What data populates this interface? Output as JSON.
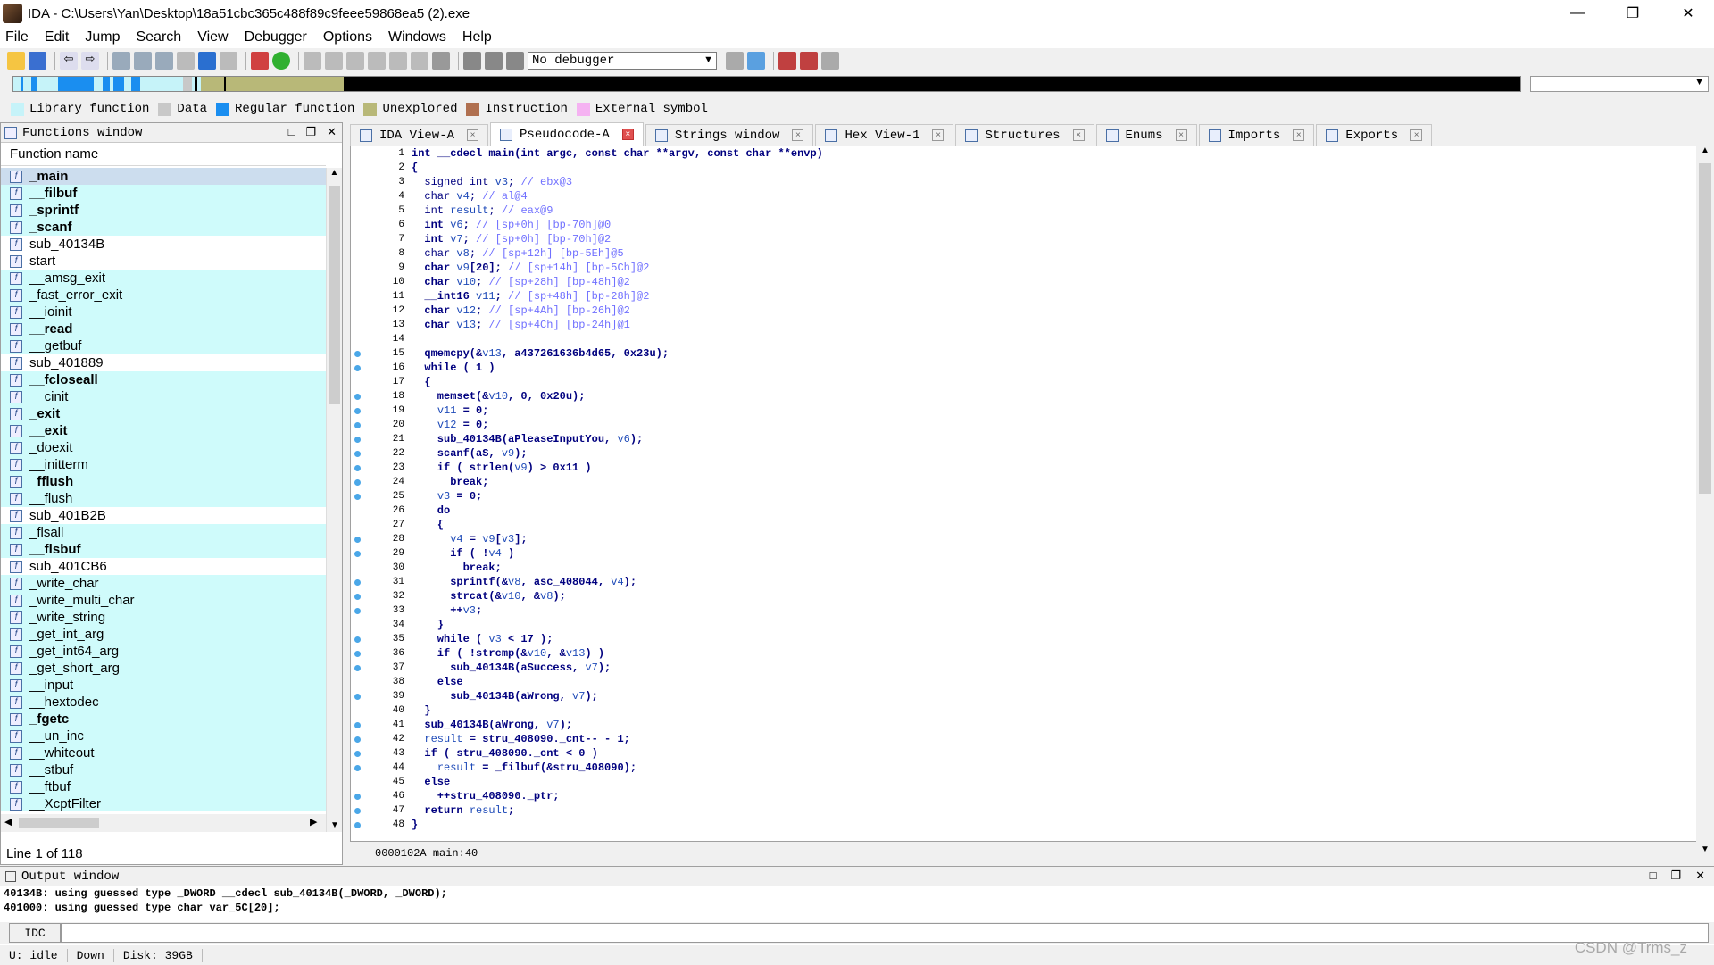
{
  "window": {
    "title": "IDA - C:\\Users\\Yan\\Desktop\\18a51cbc365c488f89c9feee59868ea5 (2).exe"
  },
  "menu": [
    "File",
    "Edit",
    "Jump",
    "Search",
    "View",
    "Debugger",
    "Options",
    "Windows",
    "Help"
  ],
  "toolbar": {
    "debugger_select": "No debugger"
  },
  "legend": [
    {
      "label": "Library function",
      "color": "#c6f3f9"
    },
    {
      "label": "Data",
      "color": "#c8c8c8"
    },
    {
      "label": "Regular function",
      "color": "#1a8ef0"
    },
    {
      "label": "Unexplored",
      "color": "#b8b878"
    },
    {
      "label": "Instruction",
      "color": "#b07050"
    },
    {
      "label": "External symbol",
      "color": "#f5b2f2"
    }
  ],
  "functions_window": {
    "title": "Functions window",
    "column": "Function name",
    "status": "Line 1 of 118",
    "items": [
      {
        "name": "_main",
        "bold": true,
        "lib": true
      },
      {
        "name": "__filbuf",
        "bold": true,
        "lib": true
      },
      {
        "name": "_sprintf",
        "bold": true,
        "lib": true
      },
      {
        "name": "_scanf",
        "bold": true,
        "lib": true
      },
      {
        "name": "sub_40134B",
        "bold": false,
        "lib": false
      },
      {
        "name": "start",
        "bold": false,
        "lib": false
      },
      {
        "name": "__amsg_exit",
        "bold": false,
        "lib": true
      },
      {
        "name": "_fast_error_exit",
        "bold": false,
        "lib": true
      },
      {
        "name": "__ioinit",
        "bold": false,
        "lib": true
      },
      {
        "name": "__read",
        "bold": true,
        "lib": true
      },
      {
        "name": "__getbuf",
        "bold": false,
        "lib": true
      },
      {
        "name": "sub_401889",
        "bold": false,
        "lib": false
      },
      {
        "name": "__fcloseall",
        "bold": true,
        "lib": true
      },
      {
        "name": "__cinit",
        "bold": false,
        "lib": true
      },
      {
        "name": "_exit",
        "bold": true,
        "lib": true
      },
      {
        "name": "__exit",
        "bold": true,
        "lib": true
      },
      {
        "name": "_doexit",
        "bold": false,
        "lib": true
      },
      {
        "name": "__initterm",
        "bold": false,
        "lib": true
      },
      {
        "name": "_fflush",
        "bold": true,
        "lib": true
      },
      {
        "name": "__flush",
        "bold": false,
        "lib": true
      },
      {
        "name": "sub_401B2B",
        "bold": false,
        "lib": false
      },
      {
        "name": "_flsall",
        "bold": false,
        "lib": true
      },
      {
        "name": "__flsbuf",
        "bold": true,
        "lib": true
      },
      {
        "name": "sub_401CB6",
        "bold": false,
        "lib": false
      },
      {
        "name": "_write_char",
        "bold": false,
        "lib": true
      },
      {
        "name": "_write_multi_char",
        "bold": false,
        "lib": true
      },
      {
        "name": "_write_string",
        "bold": false,
        "lib": true
      },
      {
        "name": "_get_int_arg",
        "bold": false,
        "lib": true
      },
      {
        "name": "_get_int64_arg",
        "bold": false,
        "lib": true
      },
      {
        "name": "_get_short_arg",
        "bold": false,
        "lib": true
      },
      {
        "name": "__input",
        "bold": false,
        "lib": true
      },
      {
        "name": "__hextodec",
        "bold": false,
        "lib": true
      },
      {
        "name": "_fgetc",
        "bold": true,
        "lib": true
      },
      {
        "name": "__un_inc",
        "bold": false,
        "lib": true
      },
      {
        "name": "__whiteout",
        "bold": false,
        "lib": true
      },
      {
        "name": "__stbuf",
        "bold": false,
        "lib": true
      },
      {
        "name": "__ftbuf",
        "bold": false,
        "lib": true
      },
      {
        "name": "__XcptFilter",
        "bold": false,
        "lib": true
      }
    ]
  },
  "tabs": [
    {
      "label": "IDA View-A",
      "active": false
    },
    {
      "label": "Pseudocode-A",
      "active": true
    },
    {
      "label": "Strings window",
      "active": false
    },
    {
      "label": "Hex View-1",
      "active": false
    },
    {
      "label": "Structures",
      "active": false
    },
    {
      "label": "Enums",
      "active": false
    },
    {
      "label": "Imports",
      "active": false
    },
    {
      "label": "Exports",
      "active": false
    }
  ],
  "pseudocode": {
    "status_addr": "0000102A",
    "status_loc": "main:40",
    "lines": [
      {
        "n": "1",
        "code": "int __cdecl main(int argc, const char **argv, const char **envp)",
        "bp": false
      },
      {
        "n": "2",
        "code": "{",
        "bp": false
      },
      {
        "n": "3",
        "code": "  signed int v3; // ebx@3",
        "bp": false
      },
      {
        "n": "4",
        "code": "  char v4; // al@4",
        "bp": false
      },
      {
        "n": "5",
        "code": "  int result; // eax@9",
        "bp": false
      },
      {
        "n": "6",
        "code": "  int v6; // [sp+0h] [bp-70h]@0",
        "bp": false
      },
      {
        "n": "7",
        "code": "  int v7; // [sp+0h] [bp-70h]@2",
        "bp": false
      },
      {
        "n": "8",
        "code": "  char v8; // [sp+12h] [bp-5Eh]@5",
        "bp": false
      },
      {
        "n": "9",
        "code": "  char v9[20]; // [sp+14h] [bp-5Ch]@2",
        "bp": false
      },
      {
        "n": "10",
        "code": "  char v10; // [sp+28h] [bp-48h]@2",
        "bp": false
      },
      {
        "n": "11",
        "code": "  __int16 v11; // [sp+48h] [bp-28h]@2",
        "bp": false
      },
      {
        "n": "12",
        "code": "  char v12; // [sp+4Ah] [bp-26h]@2",
        "bp": false
      },
      {
        "n": "13",
        "code": "  char v13; // [sp+4Ch] [bp-24h]@1",
        "bp": false
      },
      {
        "n": "14",
        "code": "",
        "bp": false
      },
      {
        "n": "15",
        "code": "  qmemcpy(&v13, a437261636b4d65, 0x23u);",
        "bp": true
      },
      {
        "n": "16",
        "code": "  while ( 1 )",
        "bp": true
      },
      {
        "n": "17",
        "code": "  {",
        "bp": false
      },
      {
        "n": "18",
        "code": "    memset(&v10, 0, 0x20u);",
        "bp": true
      },
      {
        "n": "19",
        "code": "    v11 = 0;",
        "bp": true
      },
      {
        "n": "20",
        "code": "    v12 = 0;",
        "bp": true
      },
      {
        "n": "21",
        "code": "    sub_40134B(aPleaseInputYou, v6);",
        "bp": true
      },
      {
        "n": "22",
        "code": "    scanf(aS, v9);",
        "bp": true
      },
      {
        "n": "23",
        "code": "    if ( strlen(v9) > 0x11 )",
        "bp": true
      },
      {
        "n": "24",
        "code": "      break;",
        "bp": true
      },
      {
        "n": "25",
        "code": "    v3 = 0;",
        "bp": true
      },
      {
        "n": "26",
        "code": "    do",
        "bp": false
      },
      {
        "n": "27",
        "code": "    {",
        "bp": false
      },
      {
        "n": "28",
        "code": "      v4 = v9[v3];",
        "bp": true
      },
      {
        "n": "29",
        "code": "      if ( !v4 )",
        "bp": true
      },
      {
        "n": "30",
        "code": "        break;",
        "bp": false
      },
      {
        "n": "31",
        "code": "      sprintf(&v8, asc_408044, v4);",
        "bp": true
      },
      {
        "n": "32",
        "code": "      strcat(&v10, &v8);",
        "bp": true
      },
      {
        "n": "33",
        "code": "      ++v3;",
        "bp": true
      },
      {
        "n": "34",
        "code": "    }",
        "bp": false
      },
      {
        "n": "35",
        "code": "    while ( v3 < 17 );",
        "bp": true
      },
      {
        "n": "36",
        "code": "    if ( !strcmp(&v10, &v13) )",
        "bp": true
      },
      {
        "n": "37",
        "code": "      sub_40134B(aSuccess, v7);",
        "bp": true
      },
      {
        "n": "38",
        "code": "    else",
        "bp": false
      },
      {
        "n": "39",
        "code": "      sub_40134B(aWrong, v7);",
        "bp": true
      },
      {
        "n": "40",
        "code": "  }",
        "bp": false
      },
      {
        "n": "41",
        "code": "  sub_40134B(aWrong, v7);",
        "bp": true
      },
      {
        "n": "42",
        "code": "  result = stru_408090._cnt-- - 1;",
        "bp": true
      },
      {
        "n": "43",
        "code": "  if ( stru_408090._cnt < 0 )",
        "bp": true
      },
      {
        "n": "44",
        "code": "    result = _filbuf(&stru_408090);",
        "bp": true
      },
      {
        "n": "45",
        "code": "  else",
        "bp": false
      },
      {
        "n": "46",
        "code": "    ++stru_408090._ptr;",
        "bp": true
      },
      {
        "n": "47",
        "code": "  return result;",
        "bp": true
      },
      {
        "n": "48",
        "code": "}",
        "bp": true
      }
    ]
  },
  "output": {
    "title": "Output window",
    "lines": [
      "40134B: using guessed type _DWORD __cdecl sub_40134B(_DWORD, _DWORD);",
      "401000: using guessed type char var_5C[20];"
    ],
    "idc_label": "IDC"
  },
  "statusbar": {
    "state": "U:  idle",
    "direction": "Down",
    "disk": "Disk: 39GB"
  },
  "watermark": "CSDN @Trms_z"
}
